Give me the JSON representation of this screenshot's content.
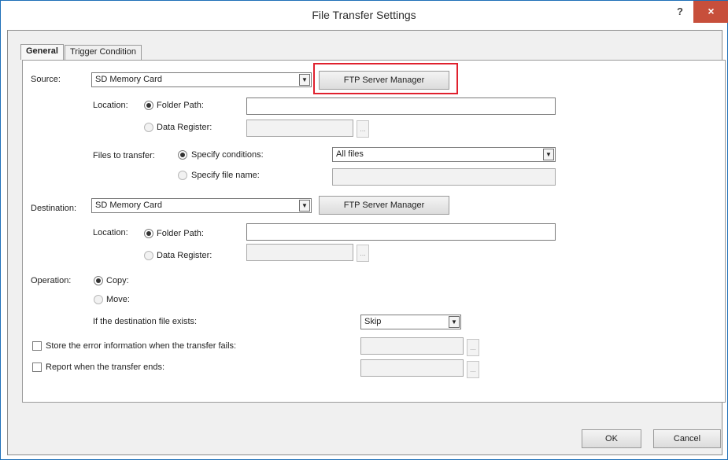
{
  "window": {
    "title": "File Transfer Settings",
    "help": "?",
    "close": "×"
  },
  "tabs": [
    "General",
    "Trigger Condition"
  ],
  "source": {
    "label": "Source:",
    "value": "SD Memory Card",
    "ftp_button": "FTP Server Manager",
    "location_label": "Location:",
    "folder_path": "Folder Path:",
    "data_register": "Data Register:",
    "files_label": "Files to transfer:",
    "specify_conditions": "Specify conditions:",
    "conditions_value": "All files",
    "specify_file_name": "Specify file name:"
  },
  "destination": {
    "label": "Destination:",
    "value": "SD Memory Card",
    "ftp_button": "FTP Server Manager",
    "location_label": "Location:",
    "folder_path": "Folder Path:",
    "data_register": "Data Register:"
  },
  "operation": {
    "label": "Operation:",
    "copy": "Copy:",
    "move": "Move:",
    "exists_label": "If the destination file exists:",
    "exists_value": "Skip"
  },
  "options": {
    "store_error": "Store the error information when the transfer fails:",
    "report": "Report when the transfer ends:"
  },
  "dots": "...",
  "buttons": {
    "ok": "OK",
    "cancel": "Cancel"
  },
  "colors": {
    "accent_border": "#1e6fb7",
    "close_bg": "#c74f3b",
    "highlight": "#e0212e"
  }
}
